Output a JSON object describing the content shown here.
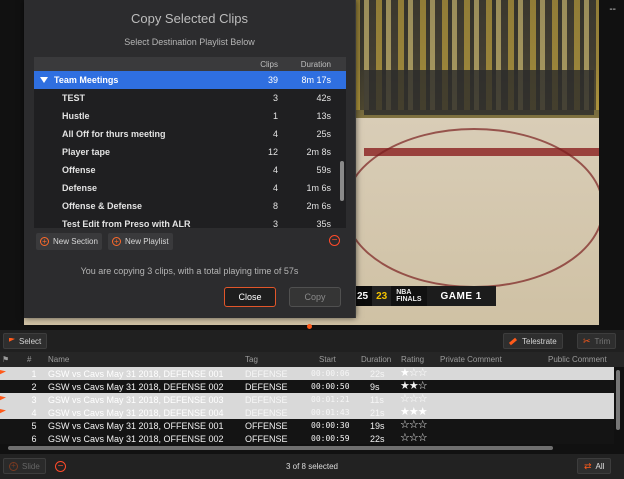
{
  "video": {
    "score": "25",
    "score_right": "23",
    "finals_line1": "NBA",
    "finals_line2": "FINALS",
    "game_label": "GAME 1",
    "corner_mark": "--"
  },
  "dialog": {
    "title": "Copy Selected Clips",
    "subtitle": "Select Destination Playlist Below",
    "columns": {
      "name": "",
      "clips": "Clips",
      "duration": "Duration"
    },
    "section": {
      "name": "Team Meetings",
      "clips": "39",
      "duration": "8m 17s"
    },
    "playlists": [
      {
        "name": "TEST",
        "clips": "3",
        "duration": "42s"
      },
      {
        "name": "Hustle",
        "clips": "1",
        "duration": "13s"
      },
      {
        "name": "All Off for thurs meeting",
        "clips": "4",
        "duration": "25s"
      },
      {
        "name": "Player tape",
        "clips": "12",
        "duration": "2m 8s"
      },
      {
        "name": "Offense",
        "clips": "4",
        "duration": "59s"
      },
      {
        "name": "Defense",
        "clips": "4",
        "duration": "1m 6s"
      },
      {
        "name": "Offense & Defense",
        "clips": "8",
        "duration": "2m 6s"
      },
      {
        "name": "Test Edit from Preso with ALR",
        "clips": "3",
        "duration": "35s"
      }
    ],
    "new_section_label": "New Section",
    "new_playlist_label": "New Playlist",
    "summary": "You are copying 3 clips, with a total playing time of 57s",
    "close_label": "Close",
    "copy_label": "Copy"
  },
  "toolbar": {
    "select_label": "Select",
    "telestrate_label": "Telestrate",
    "trim_label": "Trim"
  },
  "clip_table": {
    "columns": {
      "flag": "⚑",
      "num": "#",
      "name": "Name",
      "tag": "Tag",
      "start": "Start",
      "duration": "Duration",
      "rating": "Rating",
      "private_comment": "Private Comment",
      "public_comment": "Public Comment"
    },
    "rows": [
      {
        "flag": true,
        "num": "1",
        "name": "GSW vs Cavs May 31 2018, DEFENSE 001",
        "tag": "DEFENSE",
        "start": "00:00:06",
        "duration": "22s",
        "rating": "★☆☆",
        "selected": true
      },
      {
        "flag": false,
        "num": "2",
        "name": "GSW vs Cavs May 31 2018, DEFENSE 002",
        "tag": "DEFENSE",
        "start": "00:00:50",
        "duration": "9s",
        "rating": "★★☆",
        "selected": false
      },
      {
        "flag": true,
        "num": "3",
        "name": "GSW vs Cavs May 31 2018, DEFENSE 003",
        "tag": "DEFENSE",
        "start": "00:01:21",
        "duration": "11s",
        "rating": "☆☆☆",
        "selected": true
      },
      {
        "flag": true,
        "num": "4",
        "name": "GSW vs Cavs May 31 2018, DEFENSE 004",
        "tag": "DEFENSE",
        "start": "00:01:43",
        "duration": "21s",
        "rating": "★★★",
        "selected": true
      },
      {
        "flag": false,
        "num": "5",
        "name": "GSW vs Cavs May 31 2018, OFFENSE 001",
        "tag": "OFFENSE",
        "start": "00:00:30",
        "duration": "19s",
        "rating": "☆☆☆",
        "selected": false
      },
      {
        "flag": false,
        "num": "6",
        "name": "GSW vs Cavs May 31 2018, OFFENSE 002",
        "tag": "OFFENSE",
        "start": "00:00:59",
        "duration": "22s",
        "rating": "☆☆☆",
        "selected": false
      }
    ]
  },
  "footer": {
    "slide_label": "Slide",
    "selected_count": "3 of 8 selected",
    "all_label": "All"
  },
  "colors": {
    "accent": "#ff5a1a",
    "selection_blue": "#2f6fe0",
    "dialog_bg": "#2c2c2e"
  }
}
